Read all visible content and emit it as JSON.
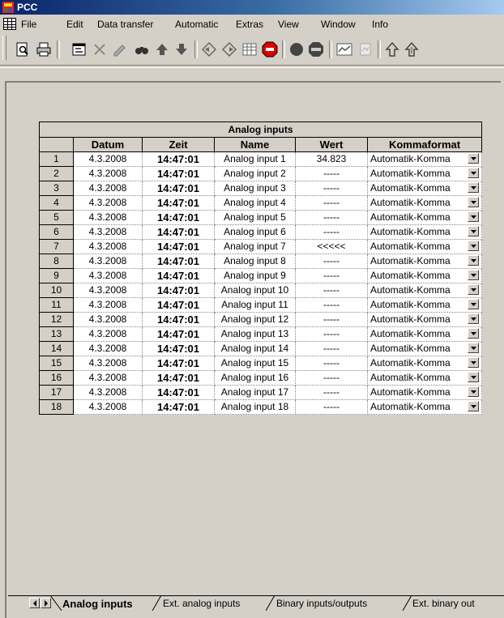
{
  "window": {
    "title": "PCC"
  },
  "menu": {
    "items": [
      "File",
      "Edit",
      "Data transfer",
      "Automatic",
      "Extras",
      "View",
      "Window",
      "Info"
    ]
  },
  "toolbar": {
    "buttons": [
      "print-preview-icon",
      "print-icon",
      "properties-icon",
      "delete-icon",
      "edit-icon",
      "find-icon",
      "arrow-up-icon",
      "arrow-down-icon",
      "connect-icon",
      "disconnect-icon",
      "table-icon",
      "stop-sign-icon",
      "record-icon",
      "stop-icon",
      "chart-icon",
      "chart-disabled-icon",
      "up-arrow-icon",
      "down-arrow-icon"
    ]
  },
  "table": {
    "banner": "Analog inputs",
    "columns": [
      "Datum",
      "Zeit",
      "Name",
      "Wert",
      "Kommaformat"
    ],
    "rows": [
      {
        "n": "1",
        "datum": "4.3.2008",
        "zeit": "14:47:01",
        "name": "Analog input 1",
        "wert": "34.823",
        "komma": "Automatik-Komma"
      },
      {
        "n": "2",
        "datum": "4.3.2008",
        "zeit": "14:47:01",
        "name": "Analog input 2",
        "wert": "-----",
        "komma": "Automatik-Komma"
      },
      {
        "n": "3",
        "datum": "4.3.2008",
        "zeit": "14:47:01",
        "name": "Analog input 3",
        "wert": "-----",
        "komma": "Automatik-Komma"
      },
      {
        "n": "4",
        "datum": "4.3.2008",
        "zeit": "14:47:01",
        "name": "Analog input 4",
        "wert": "-----",
        "komma": "Automatik-Komma"
      },
      {
        "n": "5",
        "datum": "4.3.2008",
        "zeit": "14:47:01",
        "name": "Analog input 5",
        "wert": "-----",
        "komma": "Automatik-Komma"
      },
      {
        "n": "6",
        "datum": "4.3.2008",
        "zeit": "14:47:01",
        "name": "Analog input 6",
        "wert": "-----",
        "komma": "Automatik-Komma"
      },
      {
        "n": "7",
        "datum": "4.3.2008",
        "zeit": "14:47:01",
        "name": "Analog input 7",
        "wert": "<<<<<",
        "komma": "Automatik-Komma"
      },
      {
        "n": "8",
        "datum": "4.3.2008",
        "zeit": "14:47:01",
        "name": "Analog input 8",
        "wert": "-----",
        "komma": "Automatik-Komma"
      },
      {
        "n": "9",
        "datum": "4.3.2008",
        "zeit": "14:47:01",
        "name": "Analog input 9",
        "wert": "-----",
        "komma": "Automatik-Komma"
      },
      {
        "n": "10",
        "datum": "4.3.2008",
        "zeit": "14:47:01",
        "name": "Analog input 10",
        "wert": "-----",
        "komma": "Automatik-Komma"
      },
      {
        "n": "11",
        "datum": "4.3.2008",
        "zeit": "14:47:01",
        "name": "Analog input 11",
        "wert": "-----",
        "komma": "Automatik-Komma"
      },
      {
        "n": "12",
        "datum": "4.3.2008",
        "zeit": "14:47:01",
        "name": "Analog input 12",
        "wert": "-----",
        "komma": "Automatik-Komma"
      },
      {
        "n": "13",
        "datum": "4.3.2008",
        "zeit": "14:47:01",
        "name": "Analog input 13",
        "wert": "-----",
        "komma": "Automatik-Komma"
      },
      {
        "n": "14",
        "datum": "4.3.2008",
        "zeit": "14:47:01",
        "name": "Analog input 14",
        "wert": "-----",
        "komma": "Automatik-Komma"
      },
      {
        "n": "15",
        "datum": "4.3.2008",
        "zeit": "14:47:01",
        "name": "Analog input 15",
        "wert": "-----",
        "komma": "Automatik-Komma"
      },
      {
        "n": "16",
        "datum": "4.3.2008",
        "zeit": "14:47:01",
        "name": "Analog input 16",
        "wert": "-----",
        "komma": "Automatik-Komma"
      },
      {
        "n": "17",
        "datum": "4.3.2008",
        "zeit": "14:47:01",
        "name": "Analog input 17",
        "wert": "-----",
        "komma": "Automatik-Komma"
      },
      {
        "n": "18",
        "datum": "4.3.2008",
        "zeit": "14:47:01",
        "name": "Analog input 18",
        "wert": "-----",
        "komma": "Automatik-Komma"
      }
    ]
  },
  "tabs": [
    {
      "label": "Analog inputs",
      "active": true
    },
    {
      "label": "Ext. analog inputs",
      "active": false
    },
    {
      "label": "Binary inputs/outputs",
      "active": false
    },
    {
      "label": "Ext. binary out",
      "active": false
    }
  ]
}
